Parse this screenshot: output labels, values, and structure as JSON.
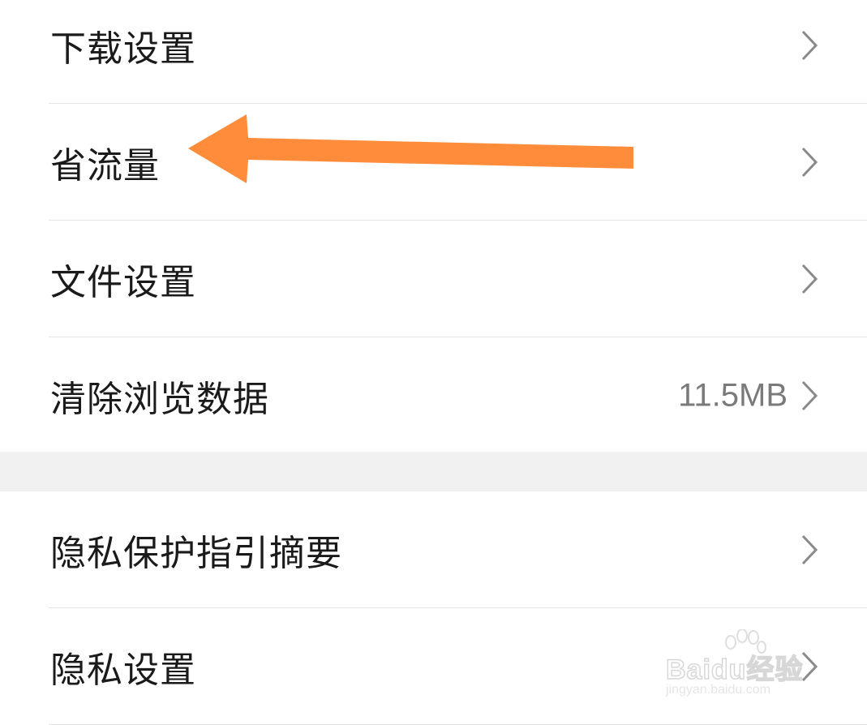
{
  "settings_group_1": {
    "items": [
      {
        "label": "下载设置",
        "value": ""
      },
      {
        "label": "省流量",
        "value": ""
      },
      {
        "label": "文件设置",
        "value": ""
      },
      {
        "label": "清除浏览数据",
        "value": "11.5MB"
      }
    ]
  },
  "settings_group_2": {
    "items": [
      {
        "label": "隐私保护指引摘要",
        "value": ""
      },
      {
        "label": "隐私设置",
        "value": ""
      }
    ]
  },
  "annotation": {
    "arrow_color": "#FF8C3A",
    "points_to": "省流量"
  },
  "watermark": {
    "brand": "Baidu经验",
    "url": "jingyan.baidu.com"
  },
  "icons": {
    "row_chevron": "chevron-right-icon"
  }
}
